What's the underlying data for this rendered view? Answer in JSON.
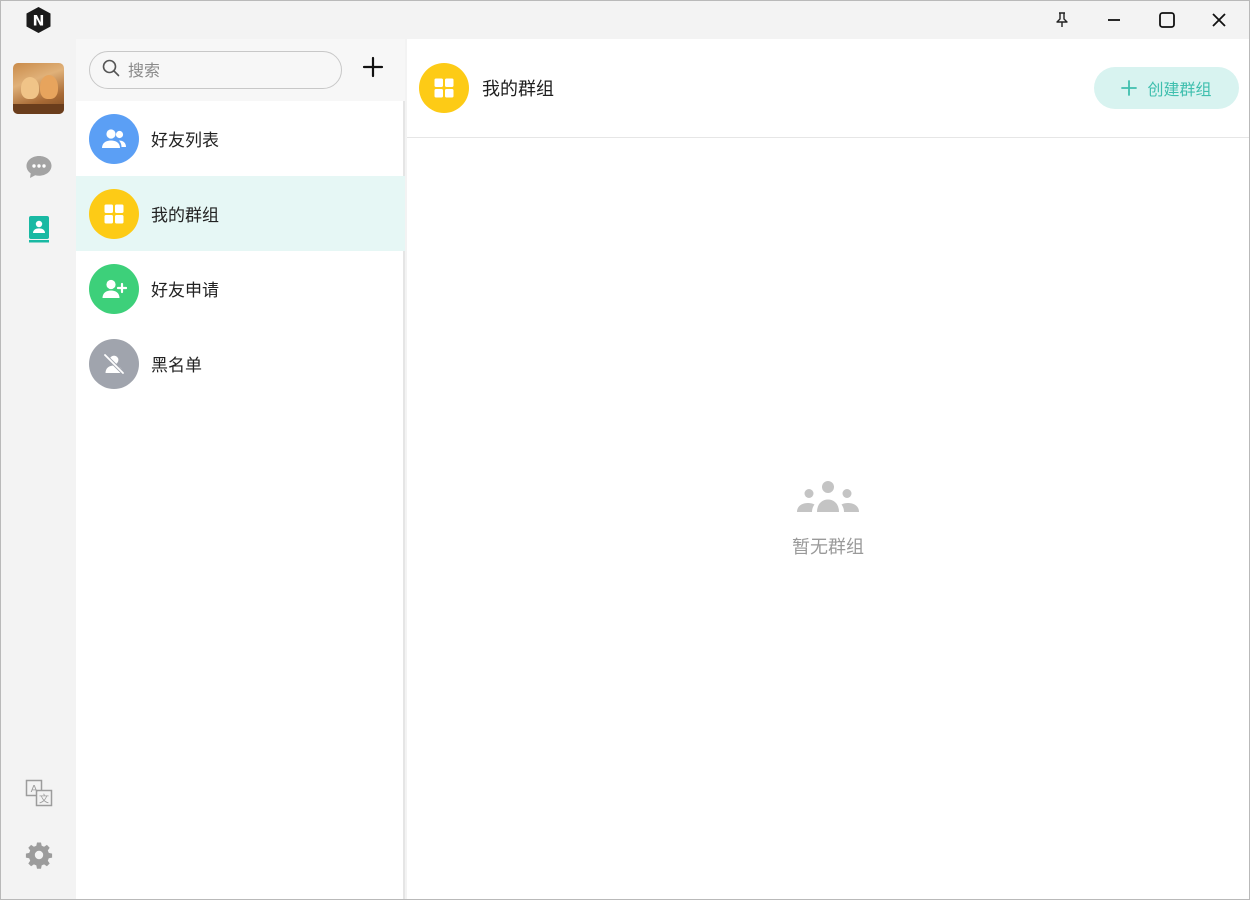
{
  "window": {
    "icons": {
      "logo": "n-hexagon-logo-icon",
      "pin": "pin-icon",
      "minimize": "minimize-icon",
      "maximize": "maximize-icon",
      "close": "close-icon"
    }
  },
  "rail": {
    "avatar": "cat-photo-avatar",
    "items": [
      {
        "name": "chat",
        "icon": "chat-bubble-icon",
        "active": false
      },
      {
        "name": "contacts",
        "icon": "contacts-book-icon",
        "active": true
      },
      {
        "name": "translate",
        "icon": "translate-icon",
        "active": false
      },
      {
        "name": "settings",
        "icon": "gear-icon",
        "active": false
      }
    ]
  },
  "search": {
    "placeholder": "搜索",
    "icon": "search-icon",
    "add_icon": "plus-icon"
  },
  "nav": {
    "items": [
      {
        "label": "好友列表",
        "icon": "friends-icon",
        "color": "#5b9ff5",
        "active": false
      },
      {
        "label": "我的群组",
        "icon": "group-grid-icon",
        "color": "#fdcb16",
        "active": true
      },
      {
        "label": "好友申请",
        "icon": "add-person-icon",
        "color": "#3dd07a",
        "active": false
      },
      {
        "label": "黑名单",
        "icon": "block-person-icon",
        "color": "#a0a4ad",
        "active": false
      }
    ]
  },
  "content": {
    "title": "我的群组",
    "title_icon": "group-grid-icon",
    "create_button": "创建群组",
    "empty_icon": "group-people-icon",
    "empty_text": "暂无群组"
  },
  "colors": {
    "accent": "#19b9a3",
    "active_row": "#e6f7f5",
    "create_btn_bg": "#d8f3f0",
    "create_btn_text": "#3fbfae"
  }
}
